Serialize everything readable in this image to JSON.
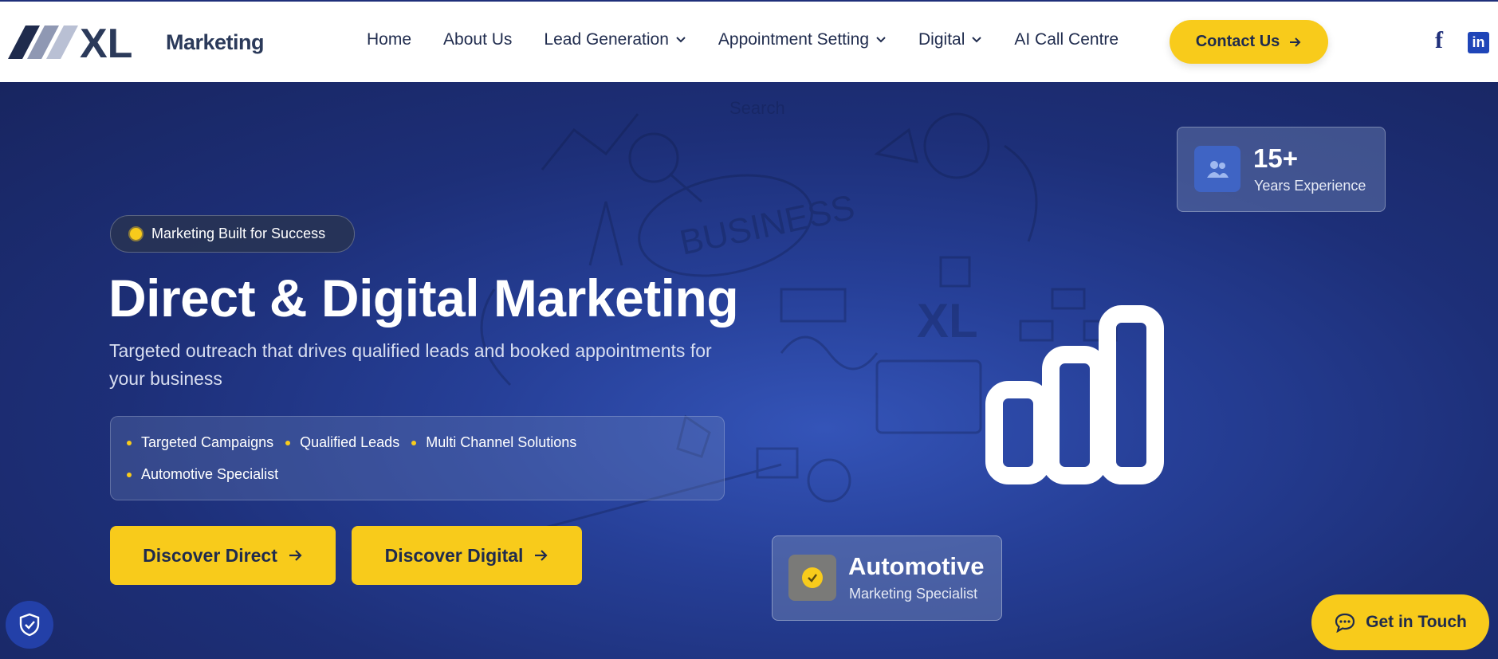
{
  "brand": {
    "logo_text": "XL",
    "name": "Marketing"
  },
  "nav": {
    "items": [
      {
        "label": "Home",
        "dropdown": false
      },
      {
        "label": "About Us",
        "dropdown": false
      },
      {
        "label": "Lead Generation",
        "dropdown": true
      },
      {
        "label": "Appointment Setting",
        "dropdown": true
      },
      {
        "label": "Digital",
        "dropdown": true
      },
      {
        "label": "AI Call Centre",
        "dropdown": false
      }
    ],
    "contact_label": "Contact Us",
    "social": {
      "facebook": "f",
      "linkedin": "in"
    }
  },
  "hero": {
    "badge": "Marketing Built for Success",
    "title": "Direct & Digital Marketing",
    "subtitle": "Targeted outreach that drives qualified leads and booked appointments for your business",
    "features_row1": [
      "Targeted Campaigns",
      "Qualified Leads",
      "Multi Channel Solutions"
    ],
    "features_row2": [
      "Automotive Specialist"
    ],
    "btn_direct": "Discover Direct",
    "btn_digital": "Discover Digital",
    "stat_number": "15+",
    "stat_label": "Years Experience",
    "auto_title": "Automotive",
    "auto_label": "Marketing Specialist",
    "doodle_words": [
      "BUSINESS",
      "Search",
      "XL"
    ]
  },
  "floating": {
    "get_in_touch": "Get in Touch"
  },
  "icons": {
    "stat": "people-icon",
    "auto": "check-circle-icon",
    "bars": "bar-chart-icon",
    "shield": "shield-check-icon",
    "chat": "chat-bubble-icon",
    "arrow": "arrow-right-icon",
    "chevron": "chevron-down-icon"
  },
  "colors": {
    "accent": "#f8cb1b",
    "navy": "#1f2b4d",
    "hero_bg": "#263f97"
  }
}
